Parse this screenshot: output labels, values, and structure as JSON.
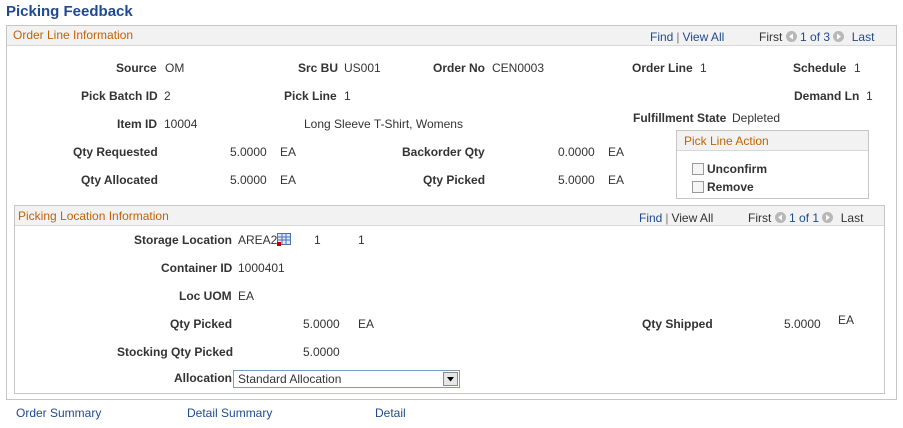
{
  "page_title": "Picking Feedback",
  "order_line": {
    "title": "Order Line Information",
    "nav": {
      "find": "Find",
      "view_all": "View All",
      "first": "First",
      "range": "1 of 3",
      "last": "Last"
    },
    "source_label": "Source",
    "source": "OM",
    "src_bu_label": "Src BU",
    "src_bu": "US001",
    "order_no_label": "Order No",
    "order_no": "CEN0003",
    "order_line_label": "Order Line",
    "order_line": "1",
    "schedule_label": "Schedule",
    "schedule": "1",
    "pick_batch_label": "Pick Batch ID",
    "pick_batch": "2",
    "pick_line_label": "Pick Line",
    "pick_line": "1",
    "demand_ln_label": "Demand Ln",
    "demand_ln": "1",
    "item_id_label": "Item ID",
    "item_id": "10004",
    "item_desc": "Long Sleeve T-Shirt, Womens",
    "fulfillment_label": "Fulfillment State",
    "fulfillment": "Depleted",
    "qty_requested_label": "Qty Requested",
    "qty_requested": "5.0000",
    "qty_requested_uom": "EA",
    "backorder_label": "Backorder Qty",
    "backorder": "0.0000",
    "backorder_uom": "EA",
    "qty_allocated_label": "Qty Allocated",
    "qty_allocated": "5.0000",
    "qty_allocated_uom": "EA",
    "qty_picked_label": "Qty Picked",
    "qty_picked": "5.0000",
    "qty_picked_uom": "EA"
  },
  "pick_line_action": {
    "title": "Pick Line Action",
    "unconfirm": "Unconfirm",
    "remove": "Remove"
  },
  "picking_location": {
    "title": "Picking Location Information",
    "nav": {
      "find": "Find",
      "view_all": "View All",
      "first": "First",
      "range": "1 of 1",
      "last": "Last"
    },
    "storage_label": "Storage Location",
    "storage": "AREA2",
    "storage_2": "1",
    "storage_3": "1",
    "container_label": "Container ID",
    "container": "1000401",
    "loc_uom_label": "Loc UOM",
    "loc_uom": "EA",
    "qty_picked_label": "Qty Picked",
    "qty_picked": "5.0000",
    "qty_picked_uom": "EA",
    "qty_shipped_label": "Qty Shipped",
    "qty_shipped": "5.0000",
    "qty_shipped_uom": "EA",
    "stocking_label": "Stocking Qty Picked",
    "stocking": "5.0000",
    "allocation_label": "Allocation",
    "allocation": "Standard Allocation"
  },
  "footer": {
    "order_summary": "Order Summary",
    "detail_summary": "Detail Summary",
    "detail": "Detail"
  }
}
